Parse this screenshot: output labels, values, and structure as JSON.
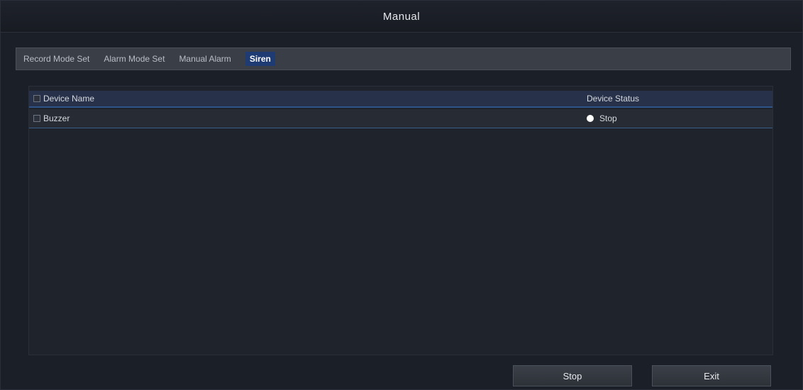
{
  "window": {
    "title": "Manual"
  },
  "tabs": [
    {
      "label": "Record Mode Set"
    },
    {
      "label": "Alarm Mode Set"
    },
    {
      "label": "Manual Alarm"
    },
    {
      "label": "Siren"
    }
  ],
  "table": {
    "headers": {
      "name": "Device Name",
      "status": "Device Status"
    },
    "rows": [
      {
        "name": "Buzzer",
        "status": "Stop"
      }
    ]
  },
  "buttons": {
    "stop": "Stop",
    "exit": "Exit"
  },
  "colors": {
    "accent": "#1f3b73",
    "row_border": "#3a5d8c",
    "background": "#1b1f28"
  }
}
